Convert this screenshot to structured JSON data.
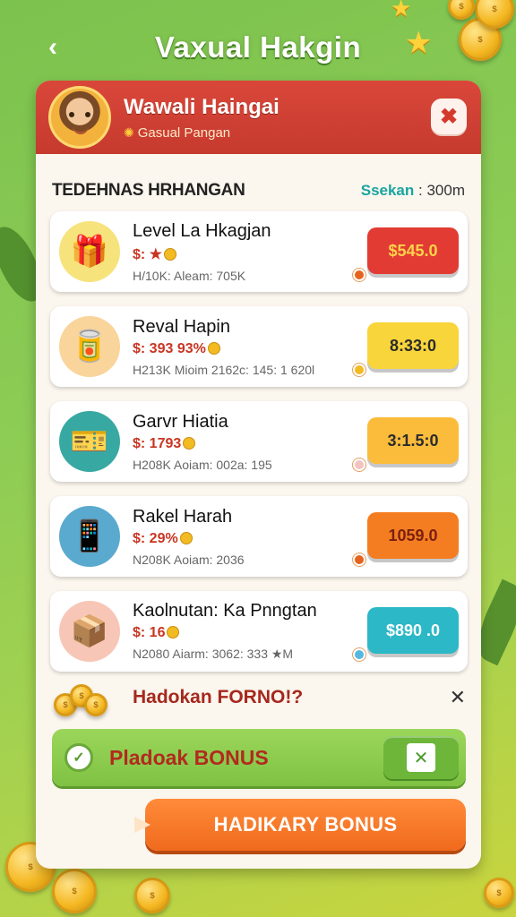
{
  "header": {
    "back_icon": "chevron-left-icon",
    "title": "Vaxual Hakgin"
  },
  "panel": {
    "title": "Wawali Haingai",
    "subtitle": "Gasual Pangan",
    "section_title": "TEDEHNAS HRHANGAN",
    "section_meta_key": "Ssekan",
    "section_meta_value": ": 300m",
    "close_icon": "close-icon"
  },
  "items": [
    {
      "name": "Level La Hkagjan",
      "price": "$: ★",
      "stats": "H/10K: Aleam: 705K",
      "button": "$545.0",
      "button_color": "#e23b34",
      "text_color": "#ffd34a",
      "icon": "gift-box-icon",
      "icon_bg": "#f6e37c",
      "glyph": "🎁",
      "badge_color": "#e6631f"
    },
    {
      "name": "Reval Hapin",
      "price": "$: 393 93%",
      "stats": "H213K Mioim 2162c: 145: 1 620l",
      "button": "8:33:0",
      "button_color": "#f8d53a",
      "text_color": "#2b2b2b",
      "icon": "cylinder-icon",
      "icon_bg": "#f9d49b",
      "glyph": "🥫",
      "badge_color": "#f3bb22"
    },
    {
      "name": "Garvr Hiatia",
      "price": "$: 1793",
      "stats": "H208K Aoiam: 002a: 195",
      "button": "3:1.5:0",
      "button_color": "#fbbc3c",
      "text_color": "#2b2b2b",
      "icon": "ticket-icon",
      "icon_bg": "#38a9a2",
      "glyph": "🎫",
      "badge_color": "#f4c3c0"
    },
    {
      "name": "Rakel Harah",
      "price": "$: 29%",
      "stats": "N208K Aoiam: 2036",
      "button": "1059.0",
      "button_color": "#f47d21",
      "text_color": "#7a1f10",
      "icon": "phone-icon",
      "icon_bg": "#5aa9cf",
      "glyph": "📱",
      "badge_color": "#e6631f"
    },
    {
      "name": "Kaolnutan: Ka Pnngtan",
      "price": "$: 16",
      "stats": "N2080 Aiarm: 3062: 333 ★M",
      "button": "$890 .0",
      "button_color": "#2cb8c6",
      "text_color": "#ffffff",
      "icon": "cube-icon",
      "icon_bg": "#f7c6b6",
      "glyph": "📦",
      "badge_color": "#55b8e0"
    }
  ],
  "bonus": {
    "question": "Hadokan FORNO!?",
    "bar_label": "Pladoak BONUS",
    "button_label": "HADIKARY BONUS"
  },
  "colors": {
    "header_red": "#d9473a",
    "bonus_green": "#7fc243",
    "claim_orange": "#f06a1c"
  }
}
